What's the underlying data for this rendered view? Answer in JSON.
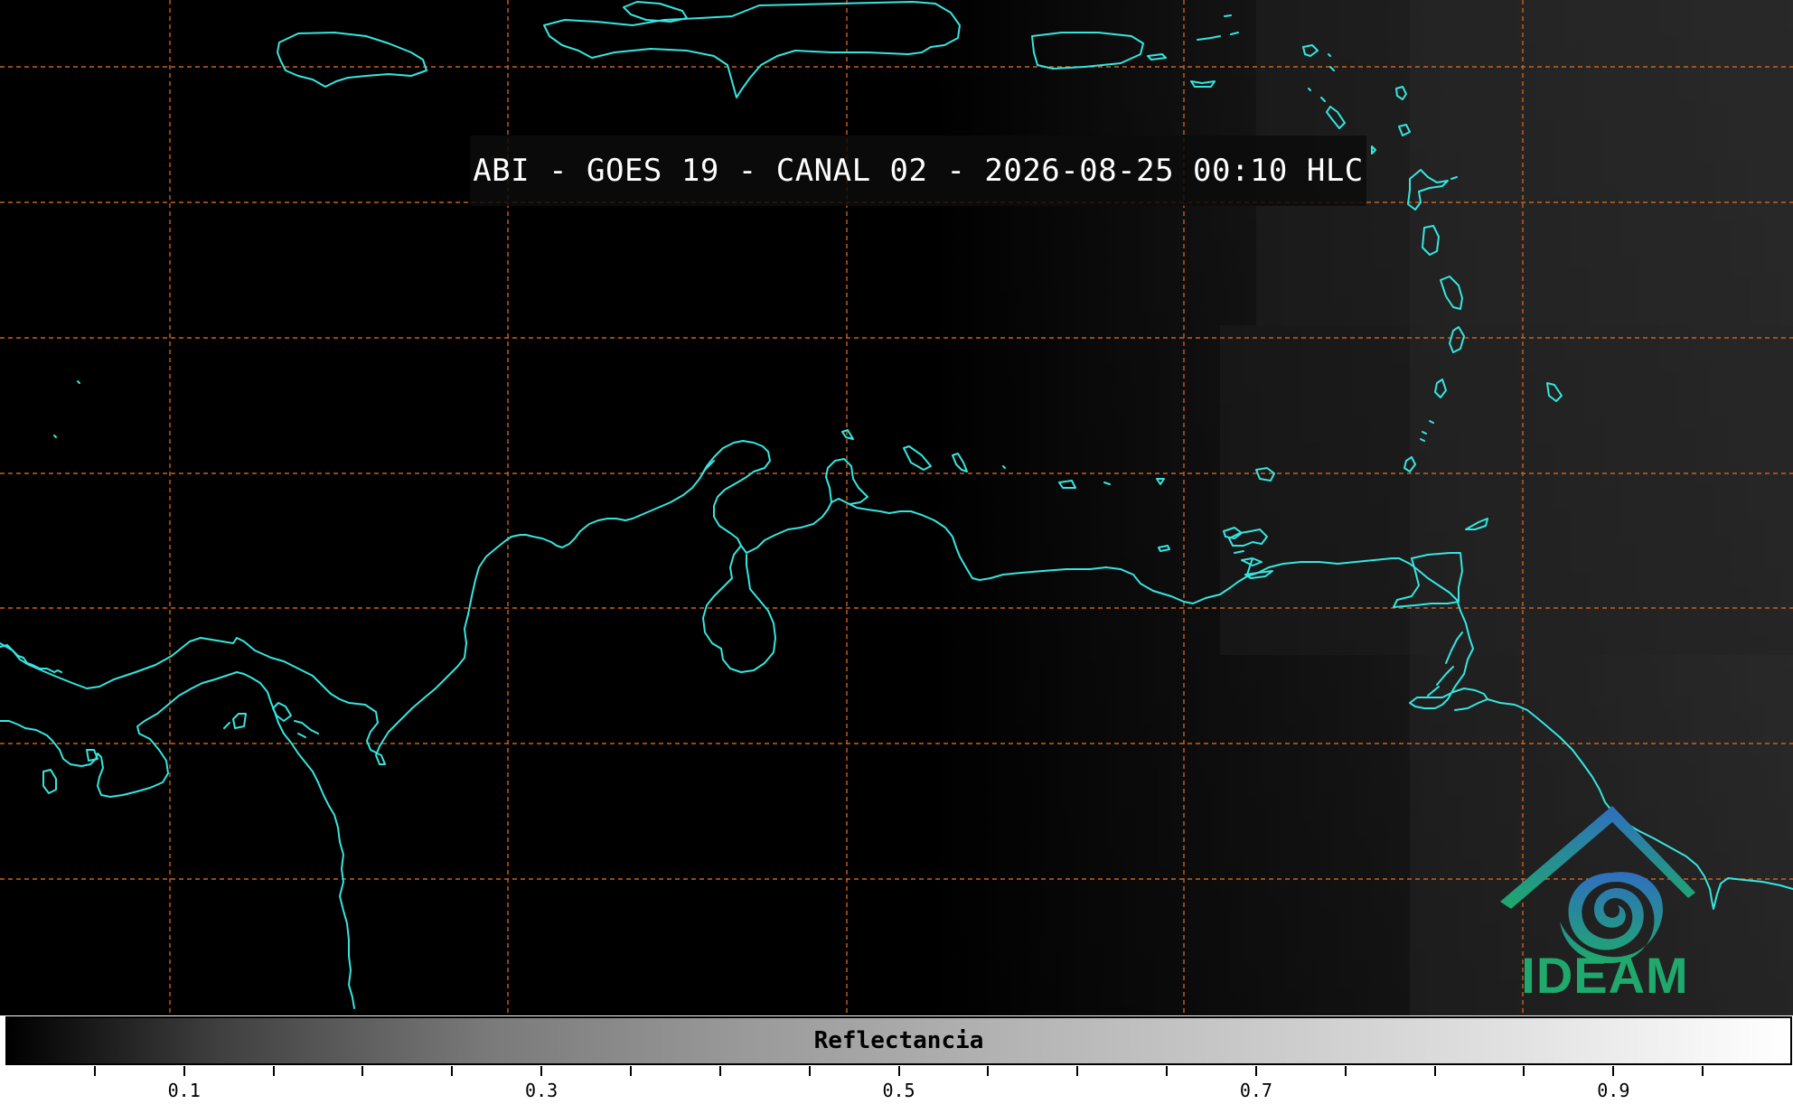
{
  "title": "ABI - GOES 19 - CANAL 02 - 2026-08-25 00:10 HLC",
  "colors": {
    "background": "#000000",
    "coastline": "#35e6e0",
    "gridlines": "#c9611d",
    "logo_blue": "#2f6fbf",
    "logo_green": "#1fa96c"
  },
  "map": {
    "imagery": "satellite visible reflectance, dark ocean, slightly brighter toward the east",
    "coastlines": "cyan outlines of the Caribbean islands and northern South/Central America",
    "gridlines": "dashed orange latitude/longitude grid"
  },
  "logo": {
    "text": "IDEAM",
    "icon": "ideam-house-swirl-icon"
  },
  "colorbar": {
    "label": "Reflectancia",
    "tick_labels": [
      "0.1",
      "0.3",
      "0.5",
      "0.7",
      "0.9"
    ],
    "major_values": [
      0.1,
      0.3,
      0.5,
      0.7,
      0.9
    ],
    "minor_values": [
      0.05,
      0.15,
      0.2,
      0.25,
      0.35,
      0.4,
      0.45,
      0.55,
      0.6,
      0.65,
      0.75,
      0.8,
      0.85,
      0.95
    ],
    "range": [
      0.0,
      1.0
    ]
  }
}
